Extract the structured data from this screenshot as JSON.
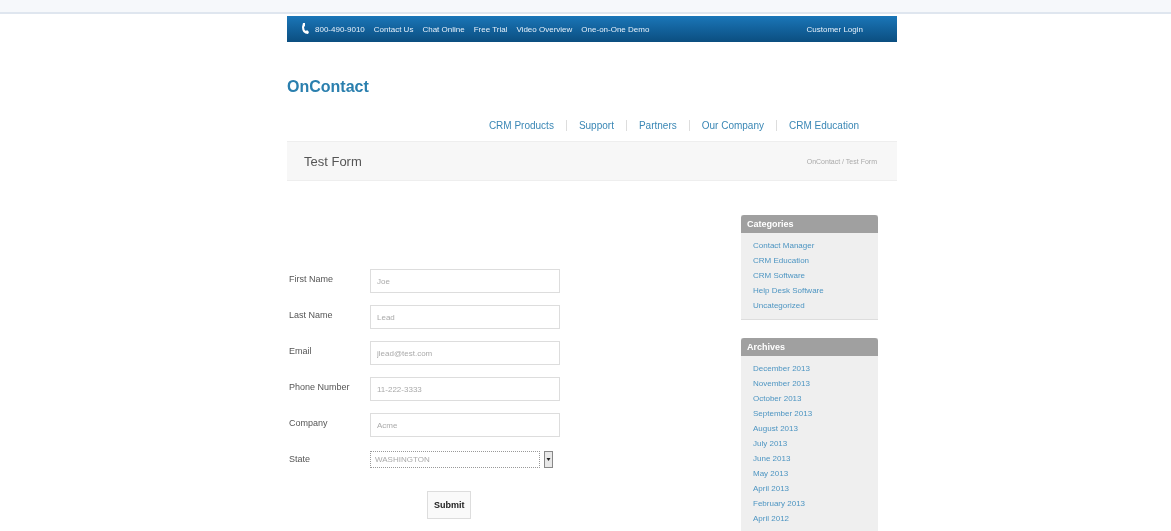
{
  "top_bar": {
    "phone": "800-490-9010",
    "links": [
      "Contact Us",
      "Chat Online",
      "Free Trial",
      "Video Overview",
      "One-on-One Demo"
    ],
    "login": "Customer Login"
  },
  "logo": "OnContact",
  "nav": [
    "CRM Products",
    "Support",
    "Partners",
    "Our Company",
    "CRM Education"
  ],
  "page_header": {
    "title": "Test Form",
    "breadcrumb": "OnContact / Test Form"
  },
  "form": {
    "fields": [
      {
        "label": "First Name",
        "kind": "text",
        "value": "Joe"
      },
      {
        "label": "Last Name",
        "kind": "text",
        "value": "Lead"
      },
      {
        "label": "Email",
        "kind": "text",
        "value": "jlead@test.com"
      },
      {
        "label": "Phone Number",
        "kind": "text",
        "value": "11-222-3333"
      },
      {
        "label": "Company",
        "kind": "text",
        "value": "Acme"
      },
      {
        "label": "State",
        "kind": "select",
        "value": "WASHINGTON"
      }
    ],
    "submit": "Submit"
  },
  "sidebar": [
    {
      "title": "Categories",
      "items": [
        "Contact Manager",
        "CRM Education",
        "CRM Software",
        "Help Desk Software",
        "Uncategorized"
      ]
    },
    {
      "title": "Archives",
      "items": [
        "December 2013",
        "November 2013",
        "October 2013",
        "September 2013",
        "August 2013",
        "July 2013",
        "June 2013",
        "May 2013",
        "April 2013",
        "February 2013",
        "April 2012"
      ]
    }
  ]
}
